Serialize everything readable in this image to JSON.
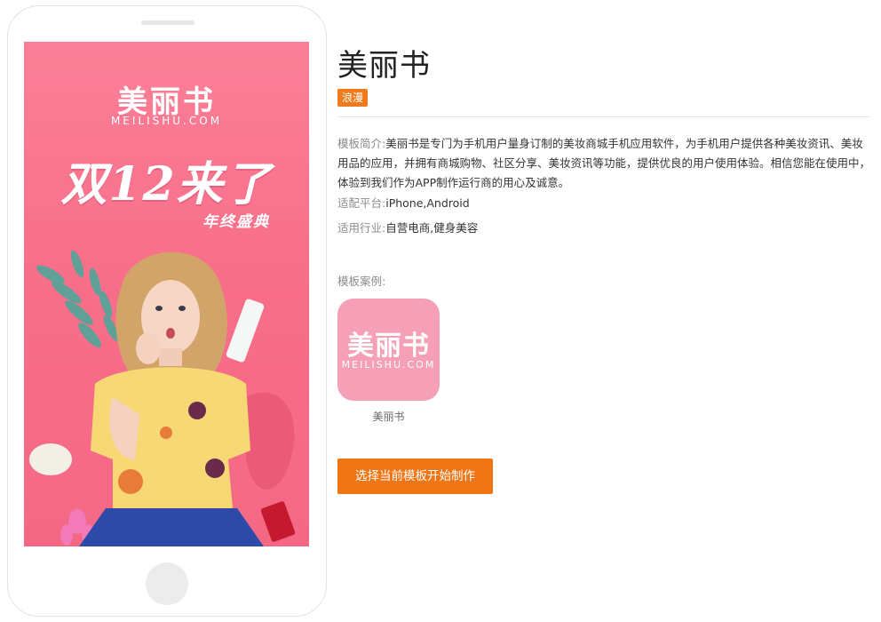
{
  "poster": {
    "brand": "美丽书",
    "domain": "MEILISHU.COM",
    "headline": "双12来了",
    "subheadline": "年终盛典",
    "background_color": "#f8758f"
  },
  "template": {
    "title": "美丽书",
    "category": "浪漫",
    "description_label": "模板简介:",
    "description": "美丽书是专门为手机用户量身订制的美妆商城手机应用软件，为手机用户提供各种美妆资讯、美妆用品的应用，并拥有商城购物、社区分享、美妆资讯等功能，提供优良的用户使用体验。相信您能在使用中，体验到我们作为APP制作运行商的用心及诚意。",
    "platform_label": "适配平台:",
    "platform": "iPhone,Android",
    "industry_label": "适用行业:",
    "industry": "自营电商,健身美容"
  },
  "cases": {
    "label": "模板案例:",
    "app_icon_title": "美丽书",
    "app_icon_domain": "MEILISHU.COM",
    "app_name": "美丽书"
  },
  "cta": {
    "label": "选择当前模板开始制作"
  },
  "colors": {
    "accent": "#f07615",
    "badge": "#f07a1c",
    "icon_pink": "#f5a0b6"
  }
}
